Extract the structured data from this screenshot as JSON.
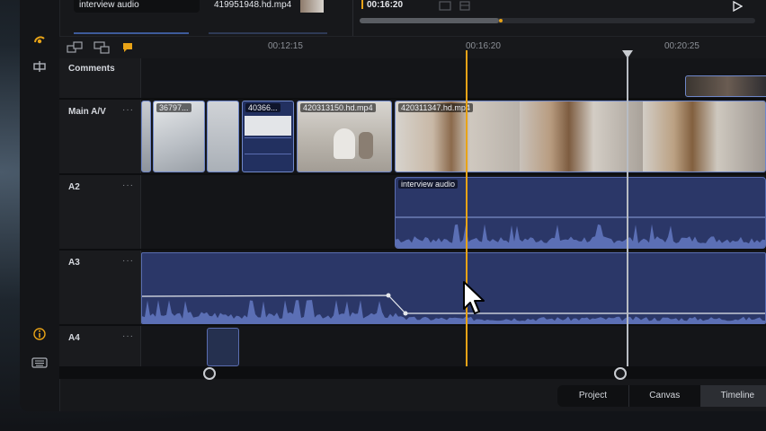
{
  "media_bin": {
    "items": [
      {
        "label": "interview audio"
      },
      {
        "label": "419951948.hd.mp4"
      }
    ]
  },
  "viewer": {
    "timecode": "00:16:20"
  },
  "ruler": {
    "labels": [
      "00:12:15",
      "00:16:20",
      "00:20:25"
    ]
  },
  "tracks": {
    "comments": {
      "label": "Comments"
    },
    "main": {
      "label": "Main A/V",
      "menu": "···"
    },
    "a2": {
      "label": "A2",
      "menu": "···"
    },
    "a3": {
      "label": "A3",
      "menu": "···"
    },
    "a4": {
      "label": "A4",
      "menu": "···"
    }
  },
  "clips": {
    "video": [
      {
        "label": "36797..."
      },
      {
        "label": "40366..."
      },
      {
        "label": "420313150.hd.mp4"
      },
      {
        "label": "420311347.hd.mp4"
      }
    ],
    "a2": {
      "label": "interview audio"
    }
  },
  "bottom_tabs": {
    "project": "Project",
    "canvas": "Canvas",
    "timeline": "Timeline"
  },
  "colors": {
    "accent": "#e8a317",
    "clip_blue": "#2b3768",
    "clip_border": "#6e86c8",
    "waveform": "#5b6fb5"
  },
  "icons": {
    "sidebar": [
      "audio-wave-icon",
      "split-clip-icon",
      "info-icon",
      "keyboard-icon"
    ],
    "toolbar": [
      "multicam-icon",
      "overlay-icon",
      "comment-icon"
    ]
  }
}
